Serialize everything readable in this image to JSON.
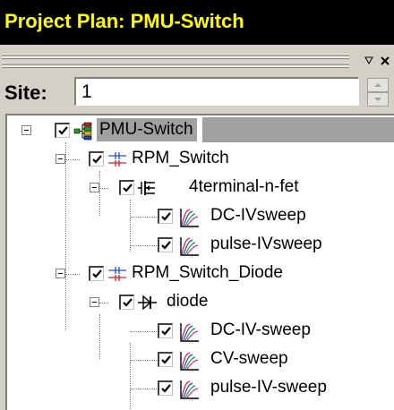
{
  "window": {
    "title": "Project Plan: PMU-Switch",
    "title_color": "#ffff00",
    "pin_icon": "pin-icon",
    "close_icon": "close-icon"
  },
  "site": {
    "label": "Site:",
    "value": "1",
    "spinner_up_icon": "spinner-up-icon",
    "spinner_down_icon": "spinner-down-icon"
  },
  "tree": {
    "items": [
      {
        "label": "PMU-Switch",
        "type": "project",
        "icon": "project-tree-icon",
        "checked": true,
        "expanded": true,
        "selected": true
      },
      {
        "label": "RPM_Switch",
        "type": "subsite",
        "icon": "rpm-switch-icon",
        "checked": true,
        "expanded": true
      },
      {
        "label": "4terminal-n-fet",
        "type": "device",
        "icon": "nfet-transistor-icon",
        "checked": true,
        "expanded": true
      },
      {
        "label": "DC-IVsweep",
        "type": "test",
        "icon": "iv-curve-icon",
        "checked": true
      },
      {
        "label": "pulse-IVsweep",
        "type": "test",
        "icon": "iv-curve-icon",
        "checked": true
      },
      {
        "label": "RPM_Switch_Diode",
        "type": "subsite",
        "icon": "rpm-switch-icon",
        "checked": true,
        "expanded": true
      },
      {
        "label": "diode",
        "type": "device",
        "icon": "diode-icon",
        "checked": true,
        "expanded": true
      },
      {
        "label": "DC-IV-sweep",
        "type": "test",
        "icon": "iv-curve-icon",
        "checked": true
      },
      {
        "label": "CV-sweep",
        "type": "test",
        "icon": "iv-curve-icon",
        "checked": true
      },
      {
        "label": "pulse-IV-sweep",
        "type": "test",
        "icon": "iv-curve-icon",
        "checked": true
      }
    ]
  }
}
